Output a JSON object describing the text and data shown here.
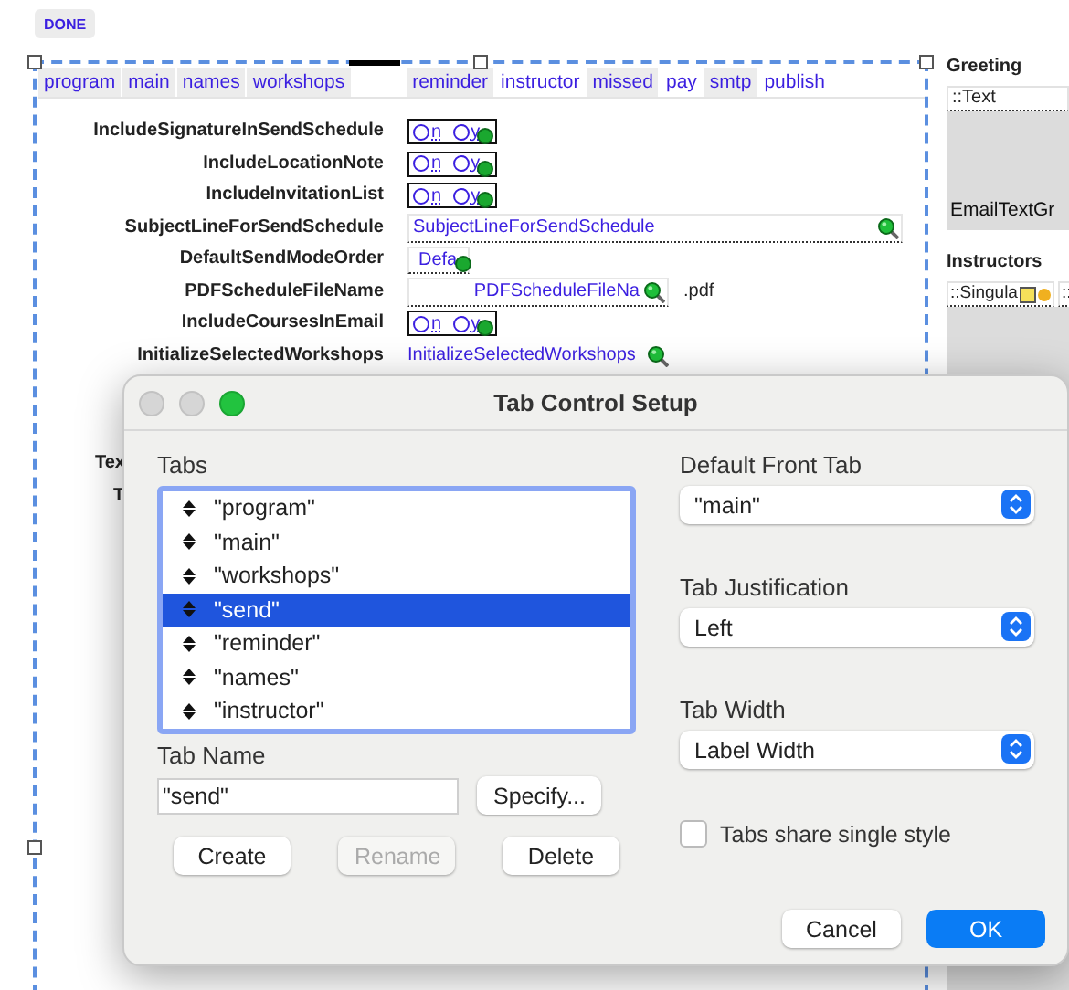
{
  "toolbar": {
    "done_button": "DONE"
  },
  "layout": {
    "tabs": [
      {
        "label": "program",
        "shaded": true
      },
      {
        "label": "main",
        "shaded": true
      },
      {
        "label": "names",
        "shaded": true
      },
      {
        "label": "workshops",
        "shaded": true
      },
      {
        "label": "reminder",
        "shaded": true,
        "gap_before": true
      },
      {
        "label": "instructor",
        "shaded": false
      },
      {
        "label": "missed",
        "shaded": true
      },
      {
        "label": "pay",
        "shaded": false
      },
      {
        "label": "smtp",
        "shaded": true
      },
      {
        "label": "publish",
        "shaded": false
      }
    ],
    "fields": [
      {
        "label": "IncludeSignatureInSendSchedule",
        "kind": "radio",
        "options": [
          "n",
          "y"
        ]
      },
      {
        "label": "IncludeLocationNote",
        "kind": "radio",
        "options": [
          "n",
          "y"
        ]
      },
      {
        "label": "IncludeInvitationList",
        "kind": "radio",
        "options": [
          "n",
          "y"
        ]
      },
      {
        "label": "SubjectLineForSendSchedule",
        "kind": "search",
        "value": "SubjectLineForSendSchedule"
      },
      {
        "label": "DefaultSendModeOrder",
        "kind": "menu",
        "value": "Defa"
      },
      {
        "label": "PDFScheduleFileName",
        "kind": "file_name",
        "value": "PDFScheduleFileNa",
        "suffix": ".pdf"
      },
      {
        "label": "IncludeCoursesInEmail",
        "kind": "radio",
        "options": [
          "n",
          "y"
        ]
      },
      {
        "label": "InitializeSelectedWorkshops",
        "kind": "script",
        "value": "InitializeSelectedWorkshops"
      }
    ],
    "covered_labels": [
      "Tex",
      "T"
    ]
  },
  "side_panel": {
    "greeting": {
      "heading": "Greeting",
      "field": "::Text",
      "preview": "EmailTextGr"
    },
    "instructors": {
      "heading": "Instructors",
      "fields": [
        "::Singula",
        "::"
      ]
    }
  },
  "dialog": {
    "title": "Tab Control Setup",
    "tabs_label": "Tabs",
    "tabs": [
      {
        "label": "\"program\"",
        "selected": false
      },
      {
        "label": "\"main\"",
        "selected": false
      },
      {
        "label": "\"workshops\"",
        "selected": false
      },
      {
        "label": "\"send\"",
        "selected": true
      },
      {
        "label": "\"reminder\"",
        "selected": false
      },
      {
        "label": "\"names\"",
        "selected": false
      },
      {
        "label": "\"instructor\"",
        "selected": false
      }
    ],
    "tab_name_label": "Tab Name",
    "tab_name": "\"send\"",
    "specify_button": "Specify...",
    "buttons": [
      {
        "label": "Create",
        "disabled": false
      },
      {
        "label": "Rename",
        "disabled": true
      },
      {
        "label": "Delete",
        "disabled": false
      }
    ],
    "popups": [
      {
        "label": "Default Front Tab",
        "value": "\"main\""
      },
      {
        "label": "Tab Justification",
        "value": "Left"
      },
      {
        "label": "Tab Width",
        "value": "Label Width"
      }
    ],
    "checkbox": {
      "label": "Tabs share single style",
      "checked": false
    },
    "footer": [
      {
        "label": "Cancel",
        "default": false
      },
      {
        "label": "OK",
        "default": true
      }
    ]
  }
}
